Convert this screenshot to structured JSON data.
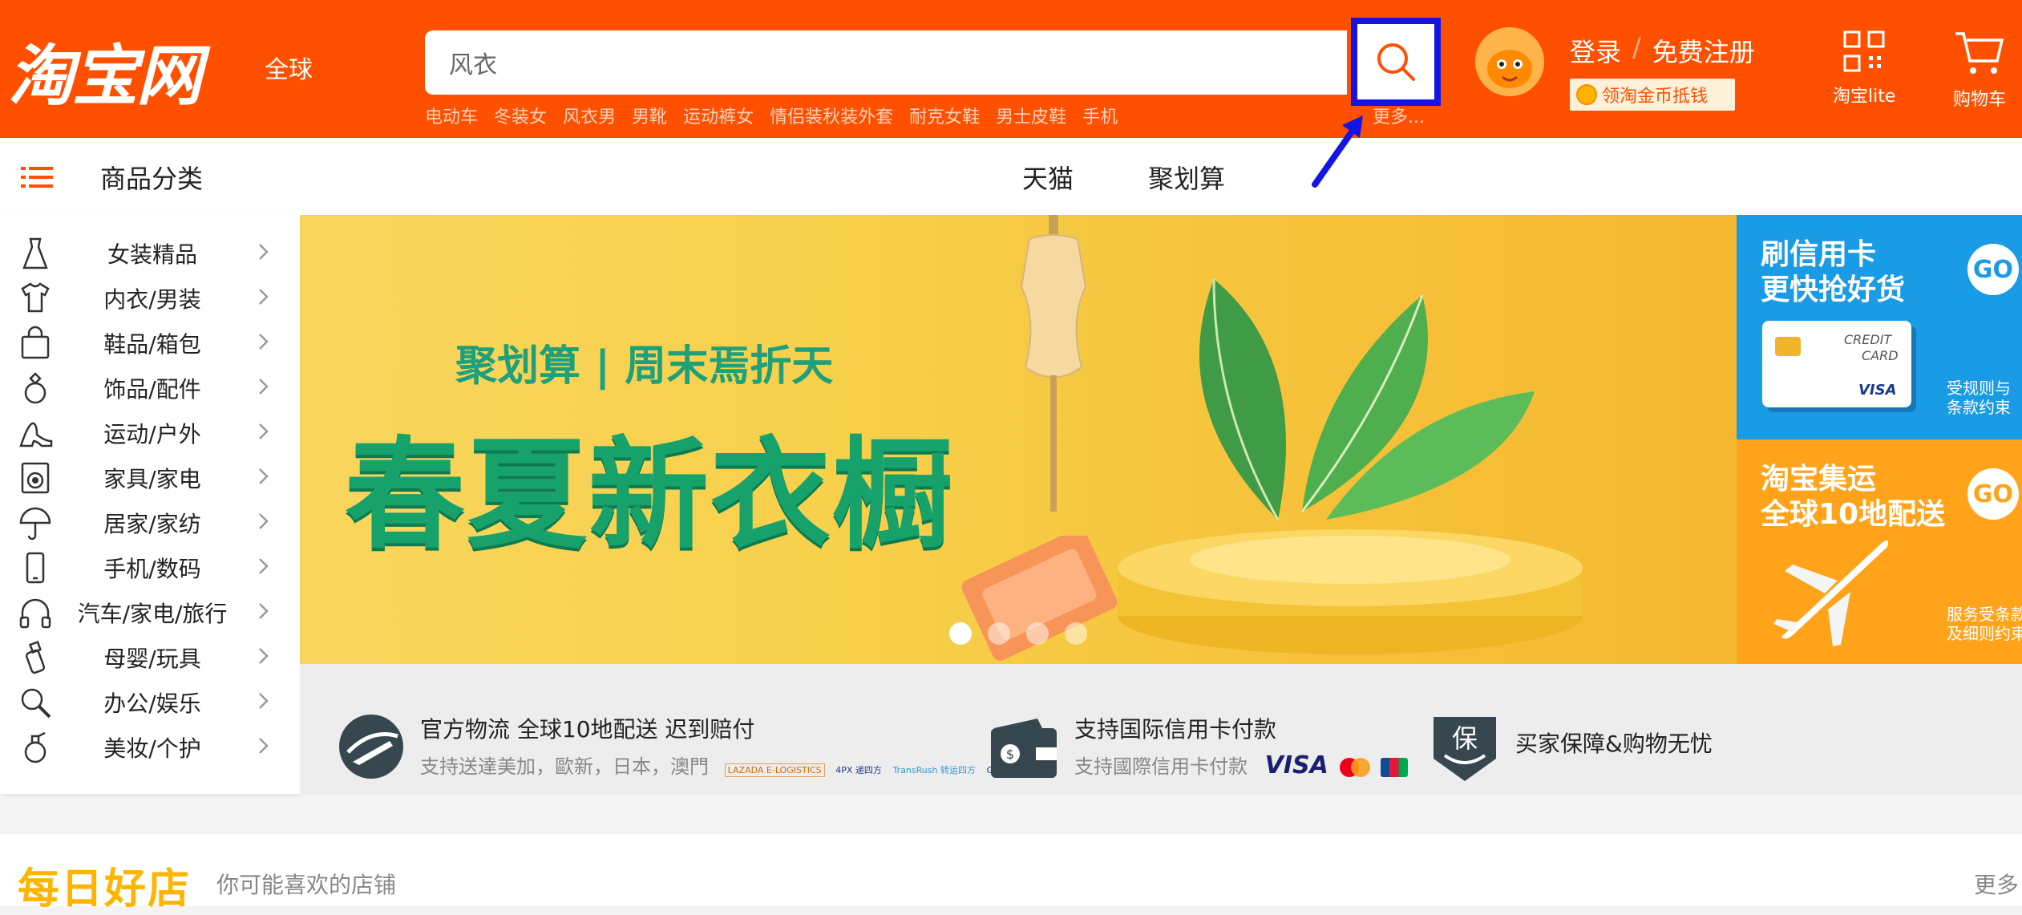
{
  "header": {
    "logo": "淘宝网",
    "logo_sub": "全球",
    "search": {
      "value": "风衣"
    },
    "hot_words": [
      "电动车",
      "冬装女",
      "风衣男",
      "男靴",
      "运动裤女",
      "情侣装秋装外套",
      "耐克女鞋",
      "男士皮鞋",
      "手机"
    ],
    "more_words": "更多...",
    "login": "登录",
    "separator": "/",
    "register": "免费注册",
    "coin_badge": "领淘金币抵钱",
    "lite_label": "淘宝lite",
    "cart_label": "购物车",
    "accent_color": "#ff5000",
    "highlight_color": "#1414e6"
  },
  "nav": {
    "category_title": "商品分类",
    "links": [
      "天猫",
      "聚划算"
    ]
  },
  "sidebar": {
    "items": [
      {
        "label": "女装精品",
        "icon": "dress-icon"
      },
      {
        "label": "内衣/男装",
        "icon": "tshirt-icon"
      },
      {
        "label": "鞋品/箱包",
        "icon": "bag-icon"
      },
      {
        "label": "饰品/配件",
        "icon": "ring-icon"
      },
      {
        "label": "运动/户外",
        "icon": "heel-icon"
      },
      {
        "label": "家具/家电",
        "icon": "washer-icon"
      },
      {
        "label": "居家/家纺",
        "icon": "umbrella-icon"
      },
      {
        "label": "手机/数码",
        "icon": "phone-icon"
      },
      {
        "label": "汽车/家电/旅行",
        "icon": "headphones-icon"
      },
      {
        "label": "母婴/玩具",
        "icon": "bottle-icon"
      },
      {
        "label": "办公/娱乐",
        "icon": "magnifier-icon"
      },
      {
        "label": "美妆/个护",
        "icon": "perfume-icon"
      }
    ]
  },
  "banner": {
    "subtitle": "聚划算 | 周末焉折天",
    "title": "春夏新衣橱",
    "slide_count": 4,
    "active_slide": 1
  },
  "promos": [
    {
      "title_line1": "刷信用卡",
      "title_line2": "更快抢好货",
      "go": "GO",
      "card_text1": "CREDIT",
      "card_text2": "CARD",
      "card_brand": "VISA",
      "note_line1": "受规则与",
      "note_line2": "条款约束",
      "color": "#1a9be6"
    },
    {
      "title_line1": "淘宝集运",
      "title_line2": "全球10地配送",
      "go": "GO",
      "note_line1": "服务受条款",
      "note_line2": "及细则约束",
      "color": "#ffa31a"
    }
  ],
  "services": [
    {
      "title": "官方物流 全球10地配送 迟到赔付",
      "desc": "支持送達美加，歐新，日本，澳門",
      "partners": [
        "LAZADA E-LOGISTICS",
        "4PX 递四方",
        "TransRush 转运四方",
        "GRID"
      ]
    },
    {
      "title": "支持国际信用卡付款",
      "desc": "支持國際信用卡付款",
      "brands": [
        "VISA"
      ]
    },
    {
      "title": "买家保障&购物无忧",
      "badge": "保"
    }
  ],
  "shops": {
    "logo": "每日好店",
    "subtitle": "你可能喜欢的店铺",
    "more": "更多"
  }
}
